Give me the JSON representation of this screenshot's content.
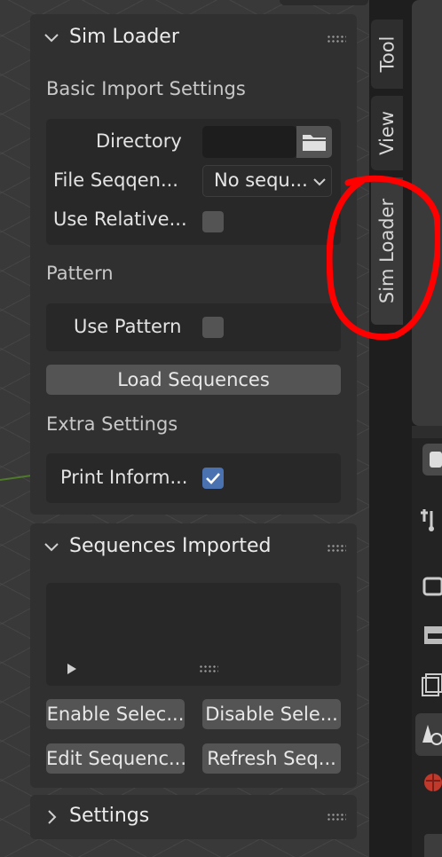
{
  "panels": {
    "sim_loader": {
      "title": "Sim Loader",
      "basic_import_label": "Basic Import Settings",
      "directory_label": "Directory",
      "directory_value": "",
      "file_sequence_label": "File Seqqen...",
      "file_sequence_value": "No sequ...",
      "use_relative_label": "Use Relative...",
      "use_relative_checked": false,
      "pattern_label": "Pattern",
      "use_pattern_label": "Use Pattern",
      "use_pattern_checked": false,
      "load_sequences_label": "Load Sequences",
      "extra_settings_label": "Extra Settings",
      "print_information_label": "Print Inform...",
      "print_information_checked": true
    },
    "sequences_imported": {
      "title": "Sequences Imported",
      "enable_selected_label": "Enable Selec...",
      "disable_selected_label": "Disable Sele...",
      "edit_sequence_label": "Edit Sequenc...",
      "refresh_sequence_label": "Refresh Seq..."
    },
    "settings": {
      "title": "Settings"
    }
  },
  "sidebar_tabs": [
    "Tool",
    "View",
    "Sim Loader"
  ],
  "active_tab": "Sim Loader",
  "colors": {
    "accent_checkbox": "#4a72b0",
    "annotation_circle": "#ff0000",
    "panel_bg": "#303030"
  },
  "icons": [
    "chevron-down-icon",
    "chevron-right-icon",
    "drag-grip-icon",
    "folder-icon",
    "dropdown-arrow-icon",
    "checkmark-icon",
    "play-triangle-icon",
    "tool-properties-icon",
    "render-icon",
    "output-icon",
    "view-layer-icon",
    "scene-icon",
    "world-icon"
  ]
}
